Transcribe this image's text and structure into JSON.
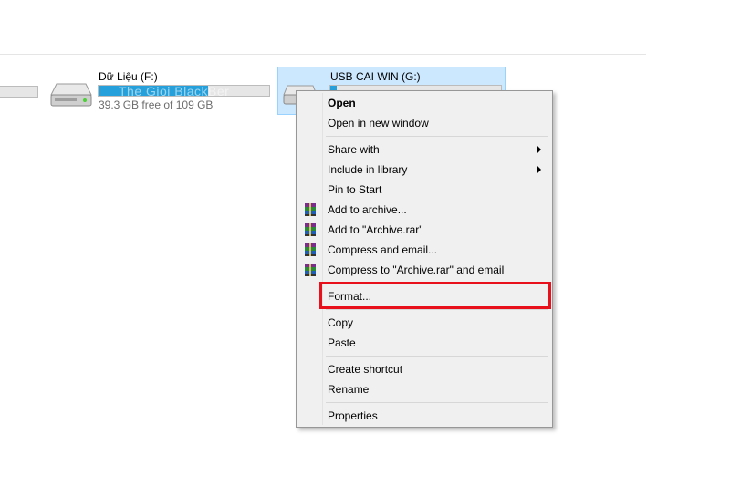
{
  "drives": [
    {
      "name": "Dữ Liệu (F:)",
      "free_text": "39.3 GB free of 109 GB",
      "usage_fraction": 0.64
    },
    {
      "name": "USB CAI WIN (G:)",
      "usage_fraction": 0.04,
      "selected": true
    }
  ],
  "watermark": "The Gioi BlackBer",
  "context_menu": {
    "items": [
      {
        "label": "Open",
        "bold": true
      },
      {
        "label": "Open in new window"
      },
      {
        "label": "Share with",
        "submenu": true
      },
      {
        "label": "Include in library",
        "submenu": true
      },
      {
        "label": "Pin to Start"
      },
      {
        "label": "Add to archive...",
        "icon": "winrar-icon"
      },
      {
        "label": "Add to \"Archive.rar\"",
        "icon": "winrar-icon"
      },
      {
        "label": "Compress and email...",
        "icon": "winrar-icon"
      },
      {
        "label": "Compress to \"Archive.rar\" and email",
        "icon": "winrar-icon"
      },
      {
        "label": "Format...",
        "highlighted": true
      },
      {
        "label": "Copy"
      },
      {
        "label": "Paste"
      },
      {
        "label": "Create shortcut"
      },
      {
        "label": "Rename"
      },
      {
        "label": "Properties"
      }
    ]
  },
  "colors": {
    "selection_bg": "#cce8ff",
    "selection_border": "#99d1ff",
    "usage_fill": "#26a0da",
    "highlight_border": "#e8101b",
    "menu_bg": "#f0f0f0"
  }
}
